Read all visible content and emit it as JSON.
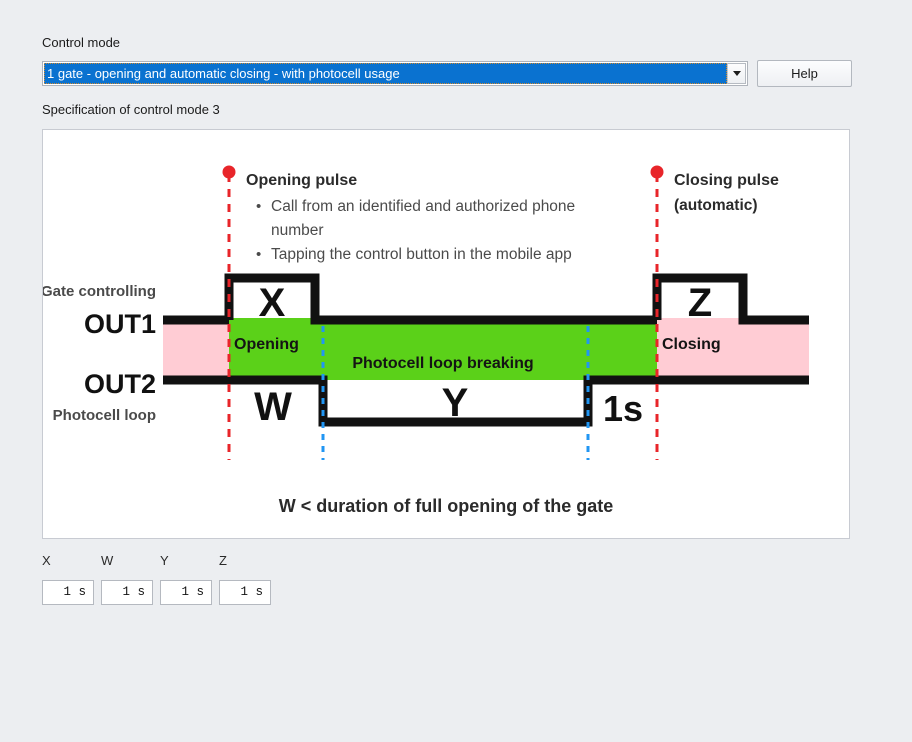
{
  "form": {
    "control_mode_label": "Control mode",
    "control_mode_value": "1 gate - opening and automatic closing - with photocell usage",
    "dropdown_icon": "chevron-down-icon",
    "help_label": "Help",
    "spec_label": "Specification of control mode 3"
  },
  "diagram": {
    "opening_pulse": {
      "title": "Opening pulse",
      "bullets": [
        "Call from an identified and authorized phone number",
        "Tapping the control button in the mobile app"
      ],
      "marker_icon": "pin-marker-icon",
      "line_color": "#e8252a"
    },
    "closing_pulse": {
      "title": "Closing pulse",
      "subtitle": "(automatic)",
      "marker_icon": "pin-marker-icon",
      "line_color": "#e8252a"
    },
    "rows": {
      "gate_controlling_label": "Gate controlling",
      "out1_label": "OUT1",
      "out2_label": "OUT2",
      "photocell_loop_label": "Photocell loop"
    },
    "pulses": {
      "x_label": "X",
      "z_label": "Z"
    },
    "bands": {
      "opening_label": "Opening",
      "photocell_break_label": "Photocell loop breaking",
      "closing_label": "Closing",
      "green_color": "#5bd119",
      "pink_color": "#ffccd4"
    },
    "intervals": {
      "w_label": "W",
      "y_label": "Y",
      "one_second_label": "1s"
    },
    "blue_marker_color": "#2196f3",
    "caption": "W < duration of full opening of the gate"
  },
  "params": {
    "columns": [
      {
        "name": "X",
        "value": "1 s"
      },
      {
        "name": "W",
        "value": "1 s"
      },
      {
        "name": "Y",
        "value": "1 s"
      },
      {
        "name": "Z",
        "value": "1 s"
      }
    ]
  }
}
